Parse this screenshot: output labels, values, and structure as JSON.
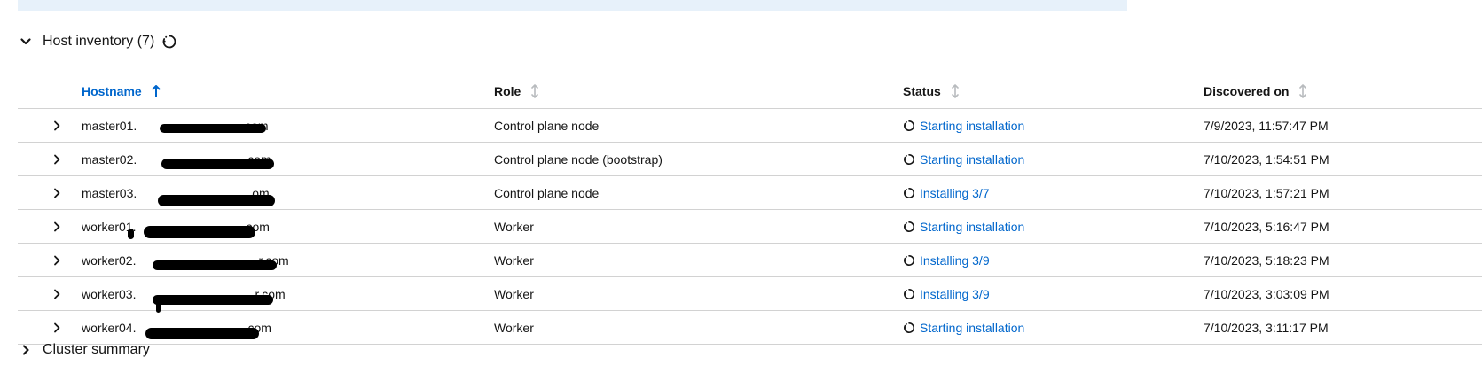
{
  "host_inventory": {
    "title": "Host inventory (7)",
    "columns": {
      "hostname": "Hostname",
      "role": "Role",
      "status": "Status",
      "discovered_on": "Discovered on"
    },
    "sort_active_column": "hostname",
    "rows": [
      {
        "hostname": "master01.",
        "hostname_suffix": ".com",
        "role": "Control plane node",
        "status": "Starting installation",
        "discovered_on": "7/9/2023, 11:57:47 PM"
      },
      {
        "hostname": "master02.",
        "hostname_suffix": "com",
        "role": "Control plane node (bootstrap)",
        "status": "Starting installation",
        "discovered_on": "7/10/2023, 1:54:51 PM"
      },
      {
        "hostname": "master03.",
        "hostname_suffix": "om",
        "role": "Control plane node",
        "status": "Installing 3/7",
        "discovered_on": "7/10/2023, 1:57:21 PM"
      },
      {
        "hostname": "worker01.",
        "hostname_suffix": "com",
        "role": "Worker",
        "status": "Starting installation",
        "discovered_on": "7/10/2023, 5:16:47 PM"
      },
      {
        "hostname": "worker02.",
        "hostname_suffix": "r.com",
        "role": "Worker",
        "status": "Installing 3/9",
        "discovered_on": "7/10/2023, 5:18:23 PM"
      },
      {
        "hostname": "worker03.",
        "hostname_suffix": "r.com",
        "role": "Worker",
        "status": "Installing 3/9",
        "discovered_on": "7/10/2023, 3:03:09 PM"
      },
      {
        "hostname": "worker04.",
        "hostname_suffix": "com",
        "role": "Worker",
        "status": "Starting installation",
        "discovered_on": "7/10/2023, 3:11:17 PM"
      }
    ]
  },
  "cluster_summary": {
    "title": "Cluster summary"
  },
  "colors": {
    "link": "#0066cc",
    "text": "#151515",
    "border": "#d2d2d2",
    "banner": "#e7f1fa",
    "sort_inactive": "#b8bbbe"
  },
  "icons": {
    "section_toggle": "chevron-down-icon",
    "row_expand": "chevron-right-icon",
    "sort_active": "arrow-up-icon",
    "sort_inactive": "sort-icon",
    "in_progress": "spinner-icon"
  }
}
